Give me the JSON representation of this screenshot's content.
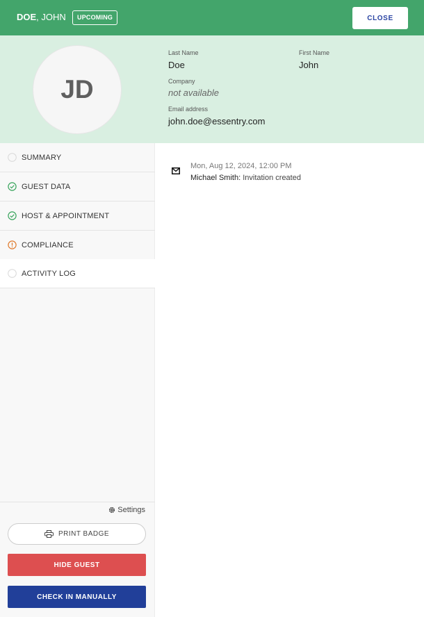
{
  "header": {
    "last_name": "DOE",
    "first_name": ", JOHN",
    "status_badge": "UPCOMING",
    "close_label": "CLOSE"
  },
  "profile": {
    "initials": "JD",
    "last_name_label": "Last Name",
    "last_name": "Doe",
    "first_name_label": "First Name",
    "first_name": "John",
    "company_label": "Company",
    "company": "not available",
    "email_label": "Email address",
    "email": "john.doe@essentry.com"
  },
  "sidebar": {
    "items": [
      {
        "label": "SUMMARY",
        "status": "empty"
      },
      {
        "label": "GUEST DATA",
        "status": "complete"
      },
      {
        "label": "HOST & APPOINTMENT",
        "status": "complete"
      },
      {
        "label": "COMPLIANCE",
        "status": "warning"
      },
      {
        "label": "ACTIVITY LOG",
        "status": "empty",
        "active": true
      }
    ],
    "settings_label": "Settings",
    "print_badge_label": "PRINT BADGE",
    "hide_guest_label": "HIDE GUEST",
    "check_in_label": "CHECK IN MANUALLY"
  },
  "activity_log": [
    {
      "icon": "envelope-icon",
      "timestamp": "Mon, Aug 12, 2024, 12:00 PM",
      "actor": "Michael Smith:",
      "action": " Invitation created"
    }
  ],
  "colors": {
    "header_bg": "#43a56b",
    "profile_bg": "#d9efe1",
    "complete": "#3aa55d",
    "warning": "#e07b2d",
    "hide_button": "#dd4f50",
    "check_in_button": "#213f99"
  }
}
